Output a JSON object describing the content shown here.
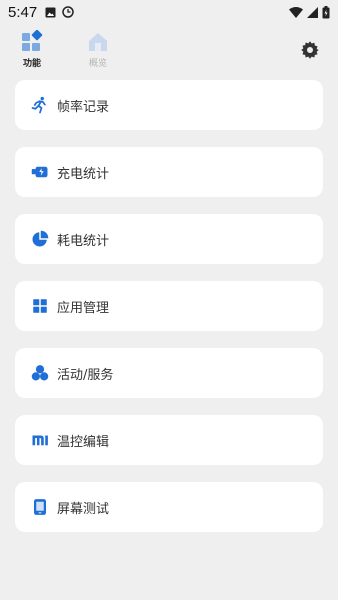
{
  "status_bar": {
    "time": "5:47"
  },
  "nav": {
    "tabs": [
      {
        "label": "功能",
        "active": true
      },
      {
        "label": "概览",
        "active": false
      }
    ]
  },
  "menu": [
    {
      "label": "帧率记录",
      "icon": "running-icon"
    },
    {
      "label": "充电统计",
      "icon": "battery-charge-icon"
    },
    {
      "label": "耗电统计",
      "icon": "pie-chart-icon"
    },
    {
      "label": "应用管理",
      "icon": "apps-grid-icon"
    },
    {
      "label": "活动/服务",
      "icon": "circles-icon"
    },
    {
      "label": "温控编辑",
      "icon": "mi-logo-icon"
    },
    {
      "label": "屏幕测试",
      "icon": "phone-screen-icon"
    }
  ],
  "colors": {
    "accent": "#1f6fd6",
    "background": "#efefef",
    "card": "#ffffff"
  }
}
